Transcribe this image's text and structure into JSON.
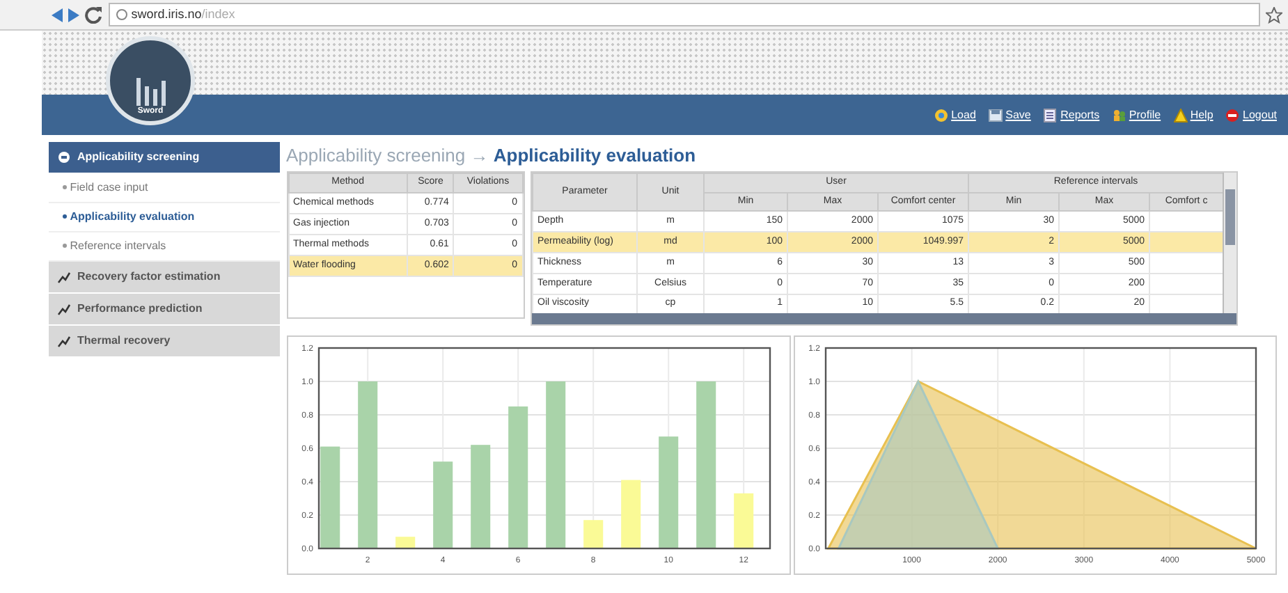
{
  "browser": {
    "address_host": "sword.iris.no",
    "address_path": "/index"
  },
  "header": {
    "logo_text": "Sword",
    "links": [
      {
        "label": "Load",
        "kind": "load"
      },
      {
        "label": "Save",
        "kind": "save"
      },
      {
        "label": "Reports",
        "kind": "reports"
      },
      {
        "label": "Profile",
        "kind": "profile"
      },
      {
        "label": "Help",
        "kind": "help"
      },
      {
        "label": "Logout",
        "kind": "logout"
      }
    ]
  },
  "sidebar": {
    "sections": [
      {
        "label": "Applicability screening",
        "selected": true,
        "children": [
          {
            "label": "Field case input",
            "selected": false
          },
          {
            "label": "Applicability evaluation",
            "selected": true
          },
          {
            "label": "Reference intervals",
            "selected": false
          }
        ]
      },
      {
        "label": "Recovery factor estimation",
        "selected": false
      },
      {
        "label": "Performance prediction",
        "selected": false
      },
      {
        "label": "Thermal recovery",
        "selected": false
      }
    ]
  },
  "breadcrumb": {
    "parent": "Applicability screening",
    "separator": "→",
    "current": "Applicability evaluation"
  },
  "methods_table": {
    "columns": [
      "Method",
      "Score",
      "Violations"
    ],
    "rows": [
      {
        "cells": [
          "Chemical methods",
          "0.774",
          "0"
        ],
        "selected": false
      },
      {
        "cells": [
          "Gas injection",
          "0.703",
          "0"
        ],
        "selected": false
      },
      {
        "cells": [
          "Thermal methods",
          "0.61",
          "0"
        ],
        "selected": false
      },
      {
        "cells": [
          "Water flooding",
          "0.602",
          "0"
        ],
        "selected": true
      }
    ]
  },
  "parameters_table": {
    "groups": [
      {
        "label": "Parameter"
      },
      {
        "label": "Unit"
      },
      {
        "label": "User",
        "columns": [
          "Min",
          "Max",
          "Comfort center"
        ]
      },
      {
        "label": "Reference intervals",
        "columns": [
          "Min",
          "Max",
          "Comfort c"
        ]
      }
    ],
    "rows": [
      {
        "cells": [
          "Depth",
          "m",
          "150",
          "2000",
          "1075",
          "30",
          "5000",
          ""
        ],
        "selected": false
      },
      {
        "cells": [
          "Permeability (log)",
          "md",
          "100",
          "2000",
          "1049.997",
          "2",
          "5000",
          ""
        ],
        "selected": true
      },
      {
        "cells": [
          "Thickness",
          "m",
          "6",
          "30",
          "13",
          "3",
          "500",
          ""
        ],
        "selected": false
      },
      {
        "cells": [
          "Temperature",
          "Celsius",
          "0",
          "70",
          "35",
          "0",
          "200",
          ""
        ],
        "selected": false
      },
      {
        "cells": [
          "Oil viscosity",
          "cp",
          "1",
          "10",
          "5.5",
          "0.2",
          "20",
          ""
        ],
        "selected": false
      }
    ]
  },
  "charts": [
    {
      "chart_data": {
        "type": "bar",
        "x": [
          1,
          2,
          3,
          4,
          5,
          6,
          7,
          8,
          9,
          10,
          11,
          12
        ],
        "grid": true,
        "series": [
          {
            "color": "#a9d3a9",
            "values": [
              0.61,
              1.0,
              null,
              0.52,
              0.62,
              0.85,
              1.0,
              null,
              null,
              0.67,
              1.0,
              null
            ]
          },
          {
            "color": "#fafa96",
            "values": [
              null,
              null,
              0.07,
              null,
              null,
              null,
              null,
              0.17,
              0.41,
              null,
              null,
              0.33
            ]
          }
        ],
        "xlim": [
          0.7,
          12.7
        ],
        "ylim": [
          0,
          1.2
        ],
        "xticks": [
          2,
          4,
          6,
          8,
          10,
          12
        ],
        "yticks": [
          {
            "value": 0,
            "label": "0.0"
          },
          {
            "value": 0.2,
            "label": "0.2"
          },
          {
            "value": 0.4,
            "label": "0.4"
          },
          {
            "value": 0.6,
            "label": "0.6"
          },
          {
            "value": 0.8,
            "label": "0.8"
          },
          {
            "value": 1,
            "label": "1.0"
          },
          {
            "value": 1.2,
            "label": "1.2"
          }
        ]
      }
    },
    {
      "chart_data": {
        "type": "area",
        "xlim": [
          0,
          5000
        ],
        "ylim": [
          0,
          1.2
        ],
        "grid": true,
        "series": [
          {
            "color": "#e8c050",
            "x": [
              30,
              1075,
              5000
            ],
            "values": [
              0,
              1,
              0
            ]
          },
          {
            "color": "#a8c8c0",
            "x": [
              150,
              1075,
              2000
            ],
            "values": [
              0,
              1,
              0
            ]
          }
        ],
        "xticks": [
          1000,
          2000,
          3000,
          4000,
          5000
        ],
        "yticks": [
          {
            "value": 0,
            "label": "0.0"
          },
          {
            "value": 0.2,
            "label": "0.2"
          },
          {
            "value": 0.4,
            "label": "0.4"
          },
          {
            "value": 0.6,
            "label": "0.6"
          },
          {
            "value": 0.8,
            "label": "0.8"
          },
          {
            "value": 1,
            "label": "1.0"
          },
          {
            "value": 1.2,
            "label": "1.2"
          }
        ]
      }
    }
  ]
}
